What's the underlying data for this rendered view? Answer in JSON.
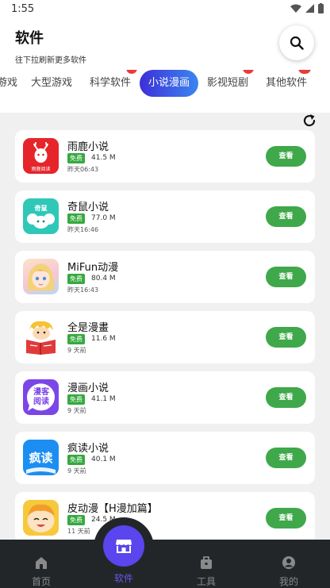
{
  "status": {
    "time": "1:55"
  },
  "header": {
    "title": "软件",
    "subtitle": "往下拉刷新更多软件"
  },
  "tabs": [
    {
      "label": "游戏",
      "badge": ""
    },
    {
      "label": "大型游戏",
      "badge": ""
    },
    {
      "label": "科学软件",
      "badge": "6"
    },
    {
      "label": "小说漫画",
      "badge": "",
      "active": true
    },
    {
      "label": "影视短剧",
      "badge": "4"
    },
    {
      "label": "其他软件",
      "badge": "50"
    }
  ],
  "apps": [
    {
      "name": "雨鹿小说",
      "tag": "免费",
      "size": "41.5 M",
      "time": "昨天06:43",
      "button": "查看",
      "icon_color": "#e5252a",
      "icon_text": "雨鹿阅读"
    },
    {
      "name": "奇鼠小说",
      "tag": "免费",
      "size": "77.0 M",
      "time": "昨天16:46",
      "button": "查看",
      "icon_color": "#2fc8b8",
      "icon_text": "奇鼠"
    },
    {
      "name": "MiFun动漫",
      "tag": "免费",
      "size": "80.4 M",
      "time": "昨天16:43",
      "button": "查看",
      "icon_color": "#f7c6d4"
    },
    {
      "name": "全是漫畫",
      "tag": "免费",
      "size": "11.6 M",
      "time": "9 天前",
      "button": "查看",
      "icon_color": "#f4c233"
    },
    {
      "name": "漫画小说",
      "tag": "免费",
      "size": "41.1 M",
      "time": "9 天前",
      "button": "查看",
      "icon_color": "#7b45e8",
      "icon_text": "漫客阅读"
    },
    {
      "name": "疯读小说",
      "tag": "免费",
      "size": "40.1 M",
      "time": "9 天前",
      "button": "查看",
      "icon_color": "#1c8ef2",
      "icon_text": "疯读"
    },
    {
      "name": "皮动漫【H漫加篇】",
      "tag": "免费",
      "size": "24.5 M",
      "time": "11 天前",
      "button": "查看",
      "icon_color": "#f6c93d"
    }
  ],
  "nav": [
    {
      "label": "首页",
      "icon": "home-icon"
    },
    {
      "label": "软件",
      "icon": "store-icon",
      "active": true
    },
    {
      "label": "工具",
      "icon": "toolbox-icon"
    },
    {
      "label": "我的",
      "icon": "profile-icon"
    }
  ]
}
